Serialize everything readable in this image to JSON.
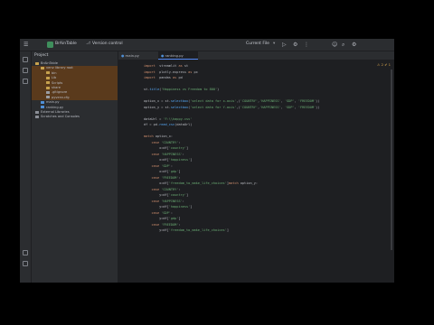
{
  "titlebar": {
    "project_badge": "B",
    "project_name": "BrAinTable",
    "vcs_label": "Version control",
    "run_config": "Current File",
    "icons": [
      "hamburger-icon",
      "run-icon",
      "debug-icon",
      "more-icon",
      "user-icon",
      "search-icon",
      "gear-icon"
    ]
  },
  "project_panel": {
    "title": "Project",
    "items": [
      {
        "label": "BrAinTable",
        "indent": 0,
        "icon": "folder",
        "state": "normal"
      },
      {
        "label": "venv  library root",
        "indent": 1,
        "icon": "folder",
        "state": "highlight"
      },
      {
        "label": "bin",
        "indent": 2,
        "icon": "folder",
        "state": "highlight"
      },
      {
        "label": "Lib",
        "indent": 2,
        "icon": "folder",
        "state": "highlight"
      },
      {
        "label": "Scripts",
        "indent": 2,
        "icon": "folder",
        "state": "highlight"
      },
      {
        "label": "share",
        "indent": 2,
        "icon": "folder",
        "state": "highlight"
      },
      {
        "label": ".gitignore",
        "indent": 2,
        "icon": "file",
        "state": "highlight"
      },
      {
        "label": "pyvenv.cfg",
        "indent": 2,
        "icon": "file",
        "state": "highlight"
      },
      {
        "label": "main.py",
        "indent": 1,
        "icon": "py",
        "state": "normal"
      },
      {
        "label": "ranking.py",
        "indent": 1,
        "icon": "py",
        "state": "normal"
      },
      {
        "label": "External Libraries",
        "indent": 0,
        "icon": "lib",
        "state": "normal"
      },
      {
        "label": "Scratches and Consoles",
        "indent": 0,
        "icon": "scratch",
        "state": "normal"
      }
    ]
  },
  "editor": {
    "tabs": [
      {
        "label": "main.py",
        "active": false
      },
      {
        "label": "ranking.py",
        "active": true
      }
    ],
    "inspection": "⚠ 2  ✔ 1",
    "lines": [
      [
        [
          "kw",
          "import"
        ],
        [
          "",
          "  streamlit "
        ],
        [
          "kw",
          "as"
        ],
        [
          "",
          " st"
        ]
      ],
      [
        [
          "kw",
          "import"
        ],
        [
          "",
          "  plotly.express "
        ],
        [
          "kw",
          "as"
        ],
        [
          "",
          " px"
        ]
      ],
      [
        [
          "kw",
          "import"
        ],
        [
          "",
          "  pandas "
        ],
        [
          "kw",
          "as"
        ],
        [
          "",
          " pd"
        ]
      ],
      [
        [
          "",
          ""
        ]
      ],
      [
        [
          "",
          "st."
        ],
        [
          "fn",
          "title"
        ],
        [
          "",
          "("
        ],
        [
          "str",
          "'Happiness vs Freedom to 800'"
        ],
        [
          "",
          ")"
        ]
      ],
      [
        [
          "",
          ""
        ]
      ],
      [
        [
          "",
          "option_x = st."
        ],
        [
          "fn",
          "selectbox"
        ],
        [
          "",
          "("
        ],
        [
          "str",
          "'select data for x-axis'"
        ],
        [
          "",
          ",("
        ],
        [
          "str",
          "'COUNTRY'"
        ],
        [
          "",
          ","
        ],
        [
          "str",
          "'HAPPINESS'"
        ],
        [
          "",
          ", "
        ],
        [
          "str",
          "'GDP'"
        ],
        [
          "",
          ", "
        ],
        [
          "str",
          "'FREEDOM'"
        ],
        [
          "",
          "))"
        ]
      ],
      [
        [
          "",
          "option_y = st."
        ],
        [
          "fn",
          "selectbox"
        ],
        [
          "",
          "("
        ],
        [
          "str",
          "'select data for Y-axis'"
        ],
        [
          "",
          ",("
        ],
        [
          "str",
          "'COUNTRY'"
        ],
        [
          "",
          ","
        ],
        [
          "str",
          "'HAPPINESS'"
        ],
        [
          "",
          ", "
        ],
        [
          "str",
          "'GDP'"
        ],
        [
          "",
          ", "
        ],
        [
          "str",
          "'FREEDOM'"
        ],
        [
          "",
          "))"
        ]
      ],
      [
        [
          "",
          ""
        ]
      ],
      [
        [
          "",
          "dataUrl = "
        ],
        [
          "str",
          "'F:\\\\happy.csv'"
        ]
      ],
      [
        [
          "",
          "df = pd."
        ],
        [
          "fn",
          "read_csv"
        ],
        [
          "",
          "(dataUrl)"
        ]
      ],
      [
        [
          "",
          ""
        ]
      ],
      [
        [
          "kw",
          "match"
        ],
        [
          "",
          " option_x:"
        ]
      ],
      [
        [
          "",
          "    "
        ],
        [
          "kw",
          "case"
        ],
        [
          "",
          " "
        ],
        [
          "str",
          "'COUNTRY'"
        ],
        [
          "",
          ":"
        ]
      ],
      [
        [
          "",
          "        x=df["
        ],
        [
          "str",
          "'country'"
        ],
        [
          "",
          "]"
        ]
      ],
      [
        [
          "",
          "    "
        ],
        [
          "kw",
          "case"
        ],
        [
          "",
          " "
        ],
        [
          "str",
          "'HAPPINESS'"
        ],
        [
          "",
          ":"
        ]
      ],
      [
        [
          "",
          "        x=df["
        ],
        [
          "str",
          "'happiness'"
        ],
        [
          "",
          "]"
        ]
      ],
      [
        [
          "",
          "    "
        ],
        [
          "kw",
          "case"
        ],
        [
          "",
          " "
        ],
        [
          "str",
          "'GDP'"
        ],
        [
          "",
          ":"
        ]
      ],
      [
        [
          "",
          "        x=df["
        ],
        [
          "str",
          "'gdp'"
        ],
        [
          "",
          "]"
        ]
      ],
      [
        [
          "",
          "    "
        ],
        [
          "kw",
          "case"
        ],
        [
          "",
          " "
        ],
        [
          "str",
          "'FREEDOM'"
        ],
        [
          "",
          ":"
        ]
      ],
      [
        [
          "",
          "        x=df["
        ],
        [
          "str",
          "'freedom_to_make_life_choices'"
        ],
        [
          "",
          "]"
        ],
        [
          "kw",
          "match"
        ],
        [
          "",
          " option_y:"
        ]
      ],
      [
        [
          "",
          "    "
        ],
        [
          "kw",
          "case"
        ],
        [
          "",
          " "
        ],
        [
          "str",
          "'COUNTRY'"
        ],
        [
          "",
          ":"
        ]
      ],
      [
        [
          "",
          "        y=df["
        ],
        [
          "str",
          "'country'"
        ],
        [
          "",
          "]"
        ]
      ],
      [
        [
          "",
          "    "
        ],
        [
          "kw",
          "case"
        ],
        [
          "",
          " "
        ],
        [
          "str",
          "'HAPPINESS'"
        ],
        [
          "",
          ":"
        ]
      ],
      [
        [
          "",
          "        y=df["
        ],
        [
          "str",
          "'happiness'"
        ],
        [
          "",
          "]"
        ]
      ],
      [
        [
          "",
          "    "
        ],
        [
          "kw",
          "case"
        ],
        [
          "",
          " "
        ],
        [
          "str",
          "'GDP'"
        ],
        [
          "",
          ":"
        ]
      ],
      [
        [
          "",
          "        y=df["
        ],
        [
          "str",
          "'gdp'"
        ],
        [
          "",
          "]"
        ]
      ],
      [
        [
          "",
          "    "
        ],
        [
          "kw",
          "case"
        ],
        [
          "",
          " "
        ],
        [
          "str",
          "'FREEDOM'"
        ],
        [
          "",
          ":"
        ]
      ],
      [
        [
          "",
          "        y=df["
        ],
        [
          "str",
          "'freedom_to_make_life_choices'"
        ],
        [
          "",
          "]"
        ]
      ]
    ]
  },
  "colors": {
    "folder": "#c7a24e",
    "file": "#9a9da3",
    "py": "#4f8fd6",
    "lib": "#8b8e96",
    "scratch": "#8b8e96"
  }
}
